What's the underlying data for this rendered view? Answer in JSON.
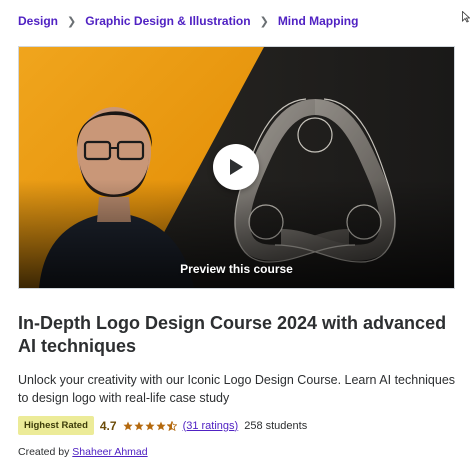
{
  "breadcrumb": {
    "items": [
      "Design",
      "Graphic Design & Illustration",
      "Mind Mapping"
    ],
    "separator": ">"
  },
  "preview": {
    "label": "Preview this course",
    "play_icon": "play-icon"
  },
  "course": {
    "title": "In-Depth Logo Design Course 2024 with advanced AI techniques",
    "subtitle": "Unlock your creativity with our Iconic Logo Design Course. Learn AI techniques to design logo with real-life case study",
    "badge": "Highest Rated",
    "rating": "4.7",
    "stars_value": 4.5,
    "ratings_count": "(31 ratings)",
    "students": "258 students",
    "created_by_label": "Created by",
    "instructor": "Shaheer Ahmad"
  },
  "colors": {
    "brand_purple": "#5022c3",
    "badge_bg": "#eceb98",
    "rating_gold": "#b4690e",
    "text_dark": "#2d2f31"
  }
}
